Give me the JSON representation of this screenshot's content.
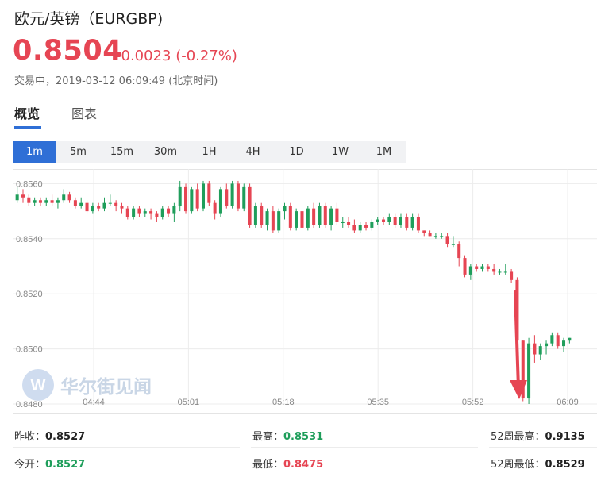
{
  "header": {
    "title": "欧元/英镑（EURGBP)",
    "price": "0.8504",
    "change": "-0.0023 (-0.27%)",
    "status": "交易中，2019-03-12 06:09:49 (北京时间)"
  },
  "tabs": [
    {
      "label": "概览",
      "active": true
    },
    {
      "label": "图表",
      "active": false
    }
  ],
  "periods": [
    {
      "label": "1m",
      "active": true
    },
    {
      "label": "5m",
      "active": false
    },
    {
      "label": "15m",
      "active": false
    },
    {
      "label": "30m",
      "active": false
    },
    {
      "label": "1H",
      "active": false
    },
    {
      "label": "4H",
      "active": false
    },
    {
      "label": "1D",
      "active": false
    },
    {
      "label": "1W",
      "active": false
    },
    {
      "label": "1M",
      "active": false
    }
  ],
  "watermark": {
    "text": "华尔街见闻"
  },
  "colors": {
    "up": "#1f9e5b",
    "down": "#e64553",
    "accent": "#2f6fd6",
    "arrow": "#e64553"
  },
  "chart_data": {
    "type": "candlestick",
    "ylim": [
      0.848,
      0.8563
    ],
    "y_ticks": [
      "0.8560",
      "0.8540",
      "0.8520",
      "0.8500",
      "0.8480"
    ],
    "x_ticks": [
      "04:44",
      "05:01",
      "05:18",
      "05:35",
      "05:52",
      "06:09"
    ],
    "grid": true,
    "annotation": "arrow-pointing-down-at-low",
    "candles": [
      [
        0.8554,
        0.8559,
        0.8553,
        0.8556
      ],
      [
        0.8556,
        0.8558,
        0.8553,
        0.8555
      ],
      [
        0.8555,
        0.8556,
        0.8552,
        0.8553
      ],
      [
        0.8553,
        0.8555,
        0.8552,
        0.8554
      ],
      [
        0.8554,
        0.8555,
        0.8552,
        0.8553
      ],
      [
        0.8553,
        0.8555,
        0.8552,
        0.8554
      ],
      [
        0.8554,
        0.8556,
        0.8552,
        0.8553
      ],
      [
        0.8553,
        0.8555,
        0.8551,
        0.8554
      ],
      [
        0.8554,
        0.8558,
        0.8553,
        0.8556
      ],
      [
        0.8556,
        0.8557,
        0.8553,
        0.8554
      ],
      [
        0.8554,
        0.8555,
        0.8551,
        0.8552
      ],
      [
        0.8552,
        0.8555,
        0.8551,
        0.8553
      ],
      [
        0.8553,
        0.8554,
        0.8549,
        0.855
      ],
      [
        0.855,
        0.8553,
        0.8549,
        0.8552
      ],
      [
        0.8552,
        0.8553,
        0.855,
        0.8551
      ],
      [
        0.8551,
        0.8555,
        0.855,
        0.8553
      ],
      [
        0.8553,
        0.8556,
        0.8552,
        0.8553
      ],
      [
        0.8553,
        0.8554,
        0.855,
        0.8552
      ],
      [
        0.8552,
        0.8553,
        0.8549,
        0.8551
      ],
      [
        0.8551,
        0.8552,
        0.8547,
        0.8548
      ],
      [
        0.8548,
        0.8552,
        0.8547,
        0.8551
      ],
      [
        0.8551,
        0.8552,
        0.8548,
        0.8549
      ],
      [
        0.8549,
        0.8551,
        0.8548,
        0.855
      ],
      [
        0.855,
        0.8551,
        0.8547,
        0.8549
      ],
      [
        0.8549,
        0.855,
        0.8546,
        0.8548
      ],
      [
        0.8548,
        0.8552,
        0.8547,
        0.8551
      ],
      [
        0.8551,
        0.8552,
        0.8548,
        0.8549
      ],
      [
        0.8549,
        0.8553,
        0.8546,
        0.8552
      ],
      [
        0.8552,
        0.8561,
        0.855,
        0.8559
      ],
      [
        0.8559,
        0.856,
        0.8549,
        0.855
      ],
      [
        0.855,
        0.8559,
        0.8549,
        0.8558
      ],
      [
        0.8558,
        0.856,
        0.855,
        0.8551
      ],
      [
        0.8551,
        0.8561,
        0.855,
        0.856
      ],
      [
        0.856,
        0.8561,
        0.8552,
        0.8553
      ],
      [
        0.8553,
        0.8554,
        0.8547,
        0.8549
      ],
      [
        0.8549,
        0.8559,
        0.8548,
        0.8558
      ],
      [
        0.8558,
        0.856,
        0.8551,
        0.8552
      ],
      [
        0.8552,
        0.8561,
        0.8551,
        0.856
      ],
      [
        0.856,
        0.8561,
        0.855,
        0.8551
      ],
      [
        0.8551,
        0.856,
        0.855,
        0.8559
      ],
      [
        0.8559,
        0.856,
        0.8544,
        0.8545
      ],
      [
        0.8545,
        0.8553,
        0.8544,
        0.8552
      ],
      [
        0.8552,
        0.8553,
        0.8544,
        0.8545
      ],
      [
        0.8545,
        0.8551,
        0.8543,
        0.855
      ],
      [
        0.855,
        0.8552,
        0.8542,
        0.8543
      ],
      [
        0.8543,
        0.8551,
        0.8542,
        0.855
      ],
      [
        0.855,
        0.8553,
        0.8547,
        0.8552
      ],
      [
        0.8552,
        0.8553,
        0.8543,
        0.8544
      ],
      [
        0.8544,
        0.8551,
        0.8543,
        0.855
      ],
      [
        0.855,
        0.8552,
        0.8543,
        0.8544
      ],
      [
        0.8544,
        0.8552,
        0.8543,
        0.8551
      ],
      [
        0.8551,
        0.8553,
        0.8544,
        0.8545
      ],
      [
        0.8545,
        0.8553,
        0.8544,
        0.8552
      ],
      [
        0.8552,
        0.8553,
        0.8544,
        0.8545
      ],
      [
        0.8545,
        0.8552,
        0.8543,
        0.8551
      ],
      [
        0.8551,
        0.8553,
        0.8545,
        0.8546
      ],
      [
        0.8546,
        0.8548,
        0.8544,
        0.8546
      ],
      [
        0.8546,
        0.8548,
        0.8544,
        0.8545
      ],
      [
        0.8545,
        0.8547,
        0.8542,
        0.8543
      ],
      [
        0.8543,
        0.8546,
        0.8542,
        0.8545
      ],
      [
        0.8545,
        0.8546,
        0.8543,
        0.8544
      ],
      [
        0.8544,
        0.8547,
        0.8543,
        0.8546
      ],
      [
        0.8546,
        0.8548,
        0.8545,
        0.8547
      ],
      [
        0.8547,
        0.8548,
        0.8545,
        0.8546
      ],
      [
        0.8546,
        0.8549,
        0.8545,
        0.8548
      ],
      [
        0.8548,
        0.8549,
        0.8544,
        0.8545
      ],
      [
        0.8545,
        0.8549,
        0.8544,
        0.8548
      ],
      [
        0.8548,
        0.8549,
        0.8543,
        0.8544
      ],
      [
        0.8544,
        0.8549,
        0.8543,
        0.8548
      ],
      [
        0.8548,
        0.8549,
        0.8542,
        0.8543
      ],
      [
        0.8543,
        0.8543,
        0.8541,
        0.8542
      ],
      [
        0.8542,
        0.8543,
        0.8541,
        0.8541
      ],
      [
        0.8541,
        0.8542,
        0.854,
        0.8541
      ],
      [
        0.8541,
        0.8542,
        0.854,
        0.8541
      ],
      [
        0.8541,
        0.8542,
        0.8537,
        0.8538
      ],
      [
        0.8538,
        0.8541,
        0.8537,
        0.8538
      ],
      [
        0.8538,
        0.8539,
        0.853,
        0.8533
      ],
      [
        0.8533,
        0.8534,
        0.8526,
        0.8527
      ],
      [
        0.8527,
        0.8531,
        0.8525,
        0.853
      ],
      [
        0.853,
        0.8531,
        0.8528,
        0.8529
      ],
      [
        0.8529,
        0.8531,
        0.8528,
        0.853
      ],
      [
        0.853,
        0.8531,
        0.8528,
        0.8529
      ],
      [
        0.8529,
        0.8531,
        0.8527,
        0.8528
      ],
      [
        0.8528,
        0.8529,
        0.8527,
        0.8528
      ],
      [
        0.8528,
        0.8531,
        0.8527,
        0.8528
      ],
      [
        0.8528,
        0.8529,
        0.8524,
        0.8525
      ],
      [
        0.8525,
        0.8526,
        0.8502,
        0.8503
      ],
      [
        0.8503,
        0.8503,
        0.8481,
        0.8482
      ],
      [
        0.8482,
        0.8504,
        0.848,
        0.8502
      ],
      [
        0.8502,
        0.8505,
        0.8495,
        0.8498
      ],
      [
        0.8498,
        0.8502,
        0.8496,
        0.8501
      ],
      [
        0.8501,
        0.8503,
        0.8498,
        0.8502
      ],
      [
        0.8502,
        0.8506,
        0.8501,
        0.8505
      ],
      [
        0.8505,
        0.8506,
        0.85,
        0.8501
      ],
      [
        0.8501,
        0.8504,
        0.8499,
        0.8503
      ],
      [
        0.8503,
        0.8504,
        0.8502,
        0.8504
      ]
    ]
  },
  "stats": [
    {
      "label": "昨收：",
      "value": "0.8527",
      "tone": "dark"
    },
    {
      "label": "最高：",
      "value": "0.8531",
      "tone": "green"
    },
    {
      "label": "52周最高：",
      "value": "0.9135",
      "tone": "dark"
    },
    {
      "label": "今开：",
      "value": "0.8527",
      "tone": "green"
    },
    {
      "label": "最低：",
      "value": "0.8475",
      "tone": "red"
    },
    {
      "label": "52周最低：",
      "value": "0.8529",
      "tone": "dark"
    }
  ]
}
